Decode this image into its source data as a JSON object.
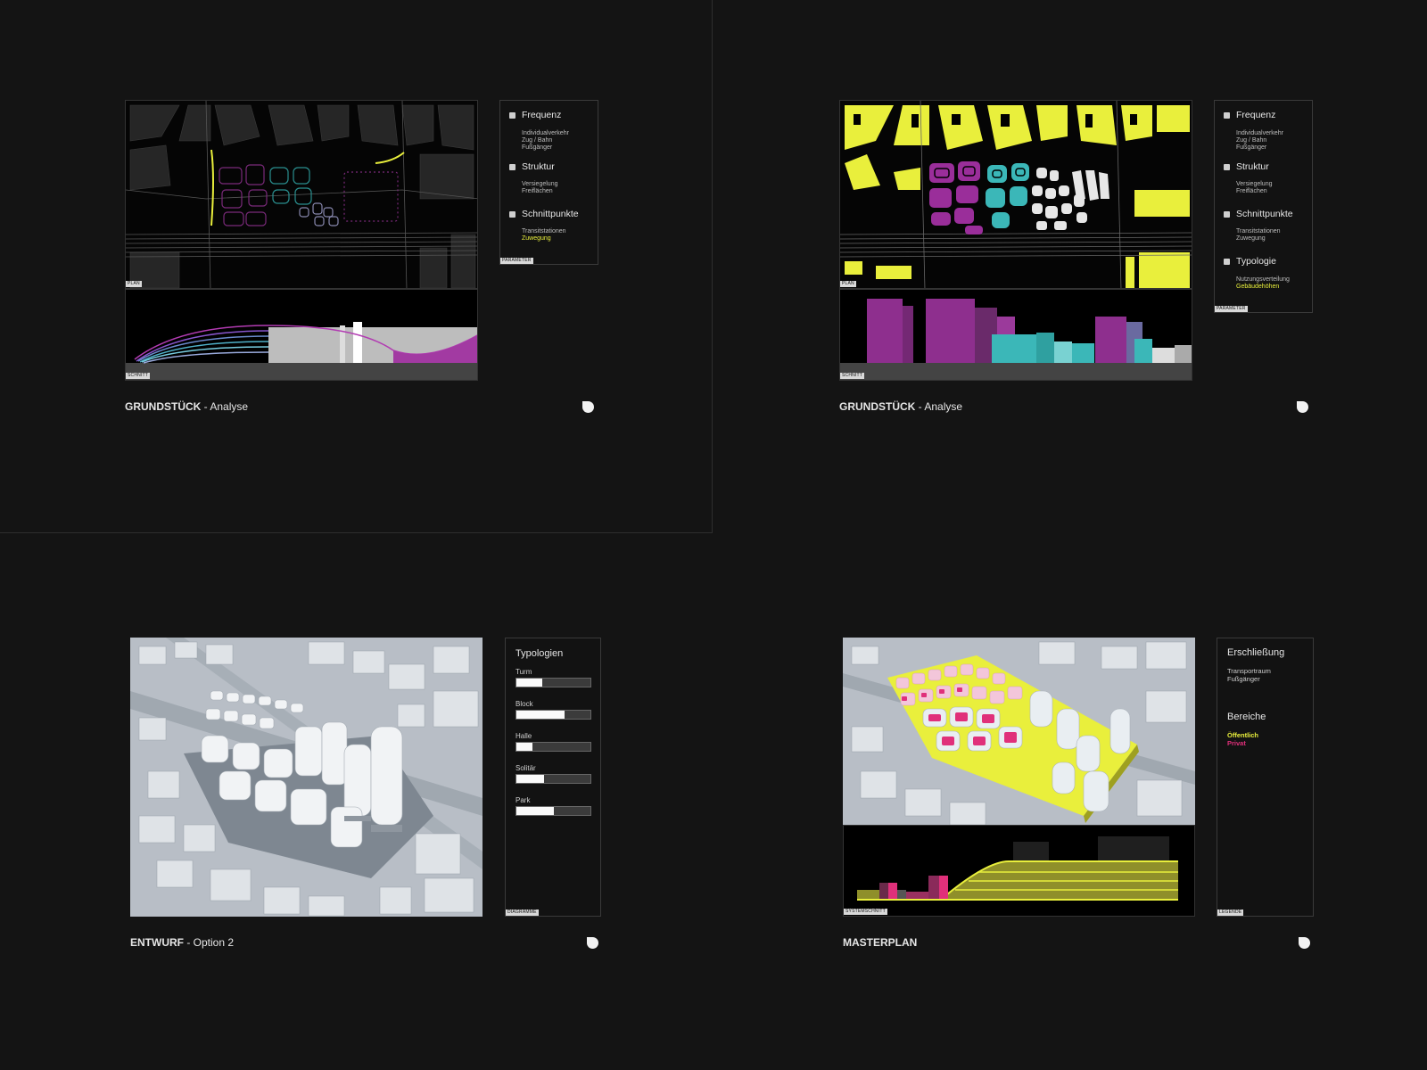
{
  "slides": {
    "s1": {
      "plan_tag": "PLAN",
      "section_tag": "SCHNITT",
      "param_tag": "PARAMETER",
      "legend": [
        {
          "title": "Frequenz",
          "items": [
            "Individualverkehr",
            "Zug / Bahn",
            "Fußgänger"
          ],
          "highlight": ""
        },
        {
          "title": "Struktur",
          "items": [
            "Versiegelung",
            "Freiflächen"
          ],
          "highlight": ""
        },
        {
          "title": "Schnittpunkte",
          "items": [
            "Transitstationen"
          ],
          "highlight": "Zuwegung"
        }
      ],
      "caption_bold": "GRUNDSTÜCK",
      "caption_rest": " - Analyse"
    },
    "s2": {
      "plan_tag": "PLAN",
      "section_tag": "SCHNITT",
      "param_tag": "PARAMETER",
      "legend": [
        {
          "title": "Frequenz",
          "items": [
            "Individualverkehr",
            "Zug / Bahn",
            "Fußgänger"
          ],
          "highlight": ""
        },
        {
          "title": "Struktur",
          "items": [
            "Versiegelung",
            "Freiflächen"
          ],
          "highlight": ""
        },
        {
          "title": "Schnittpunkte",
          "items": [
            "Transitstationen",
            "Zuwegung"
          ],
          "highlight": ""
        },
        {
          "title": "Typologie",
          "items": [
            "Nutzungsverteilung"
          ],
          "highlight": "Gebäudehöhen"
        }
      ],
      "caption_bold": "GRUNDSTÜCK",
      "caption_rest": " - Analyse"
    },
    "s3": {
      "panel_title": "Typologien",
      "panel_tag": "DIAGRAMME",
      "bars": [
        {
          "label": "Turm",
          "value": 0.35
        },
        {
          "label": "Block",
          "value": 0.65
        },
        {
          "label": "Halle",
          "value": 0.22
        },
        {
          "label": "Solitär",
          "value": 0.37
        },
        {
          "label": "Park",
          "value": 0.5
        }
      ],
      "caption_bold": "ENTWURF",
      "caption_rest": " - Option 2"
    },
    "s4": {
      "legend_title1": "Erschließung",
      "legend_items1": [
        "Transportraum",
        "Fußgänger"
      ],
      "legend_title2": "Bereiche",
      "public_label": "Öffentlich",
      "private_label": "Privat",
      "section_tag": "SYSTEMSCHNITT",
      "legend_tag": "LEGENDE",
      "caption_bold": "MASTERPLAN",
      "caption_rest": ""
    }
  },
  "colors": {
    "yellow": "#e9ef3c",
    "magenta": "#8e2f8e",
    "cyan": "#3bb7b8",
    "pink": "#e0307a"
  }
}
